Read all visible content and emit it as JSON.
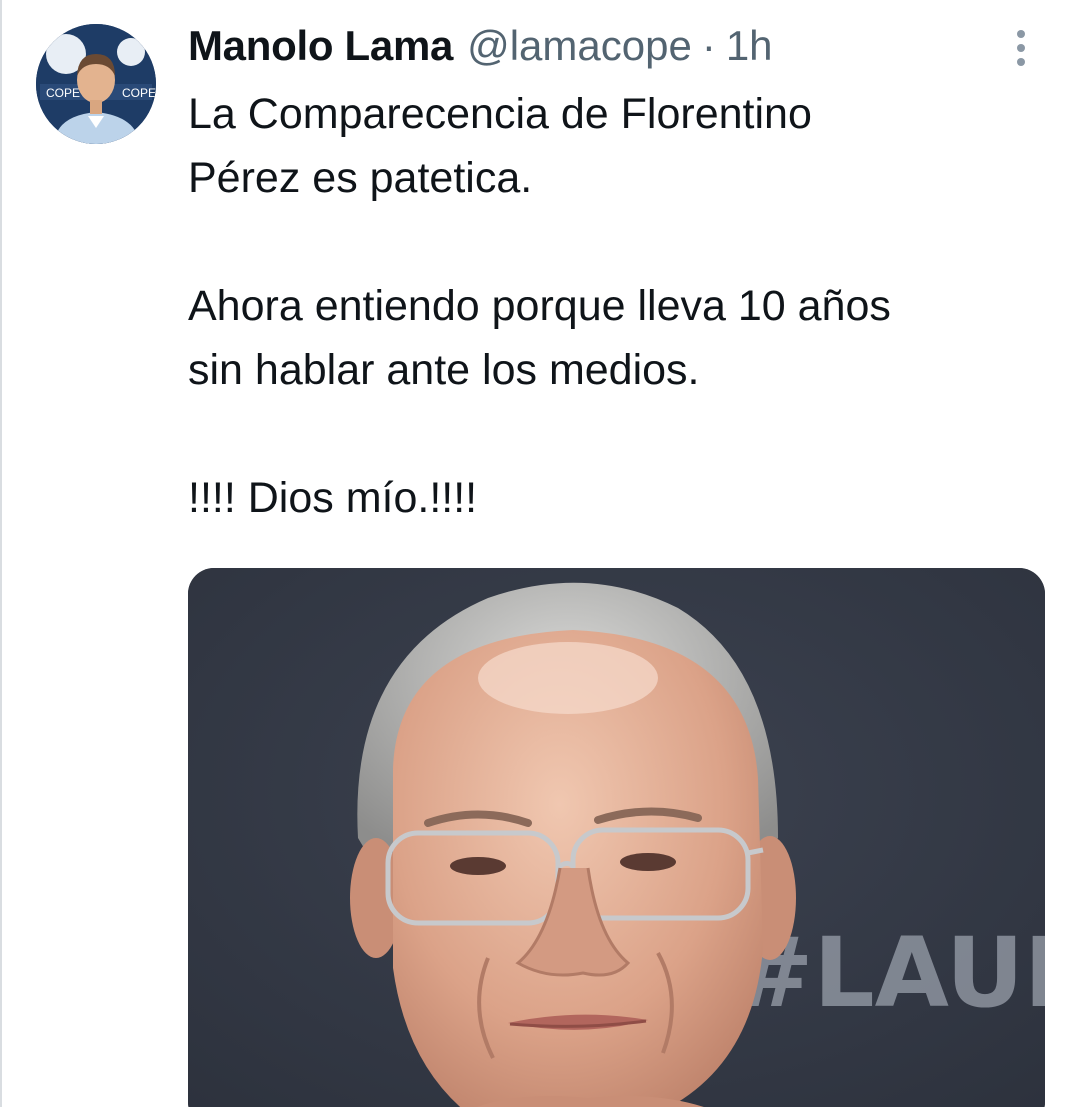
{
  "tweet": {
    "author_name": "Manolo Lama",
    "author_handle": "@lamacope",
    "separator": "·",
    "timestamp": "1h",
    "avatar": {
      "logo_text_left": "COPE",
      "logo_text_right": "COPE"
    },
    "text_paragraphs": [
      [
        "La Comparecencia de Florentino",
        "Pérez es patetica."
      ],
      [
        "Ahora entiendo porque lleva 10 años",
        "sin hablar ante los medios."
      ],
      [
        "!!!! Dios mío.!!!!"
      ]
    ],
    "media": {
      "backdrop_text": "#LAUR",
      "type": "photo"
    }
  },
  "icons": {
    "more": "more-vertical-icon"
  },
  "colors": {
    "text_primary": "#0f1419",
    "text_secondary": "#536471",
    "avatar_bg": "#1c3a63",
    "photo_bg": "#343a47"
  }
}
